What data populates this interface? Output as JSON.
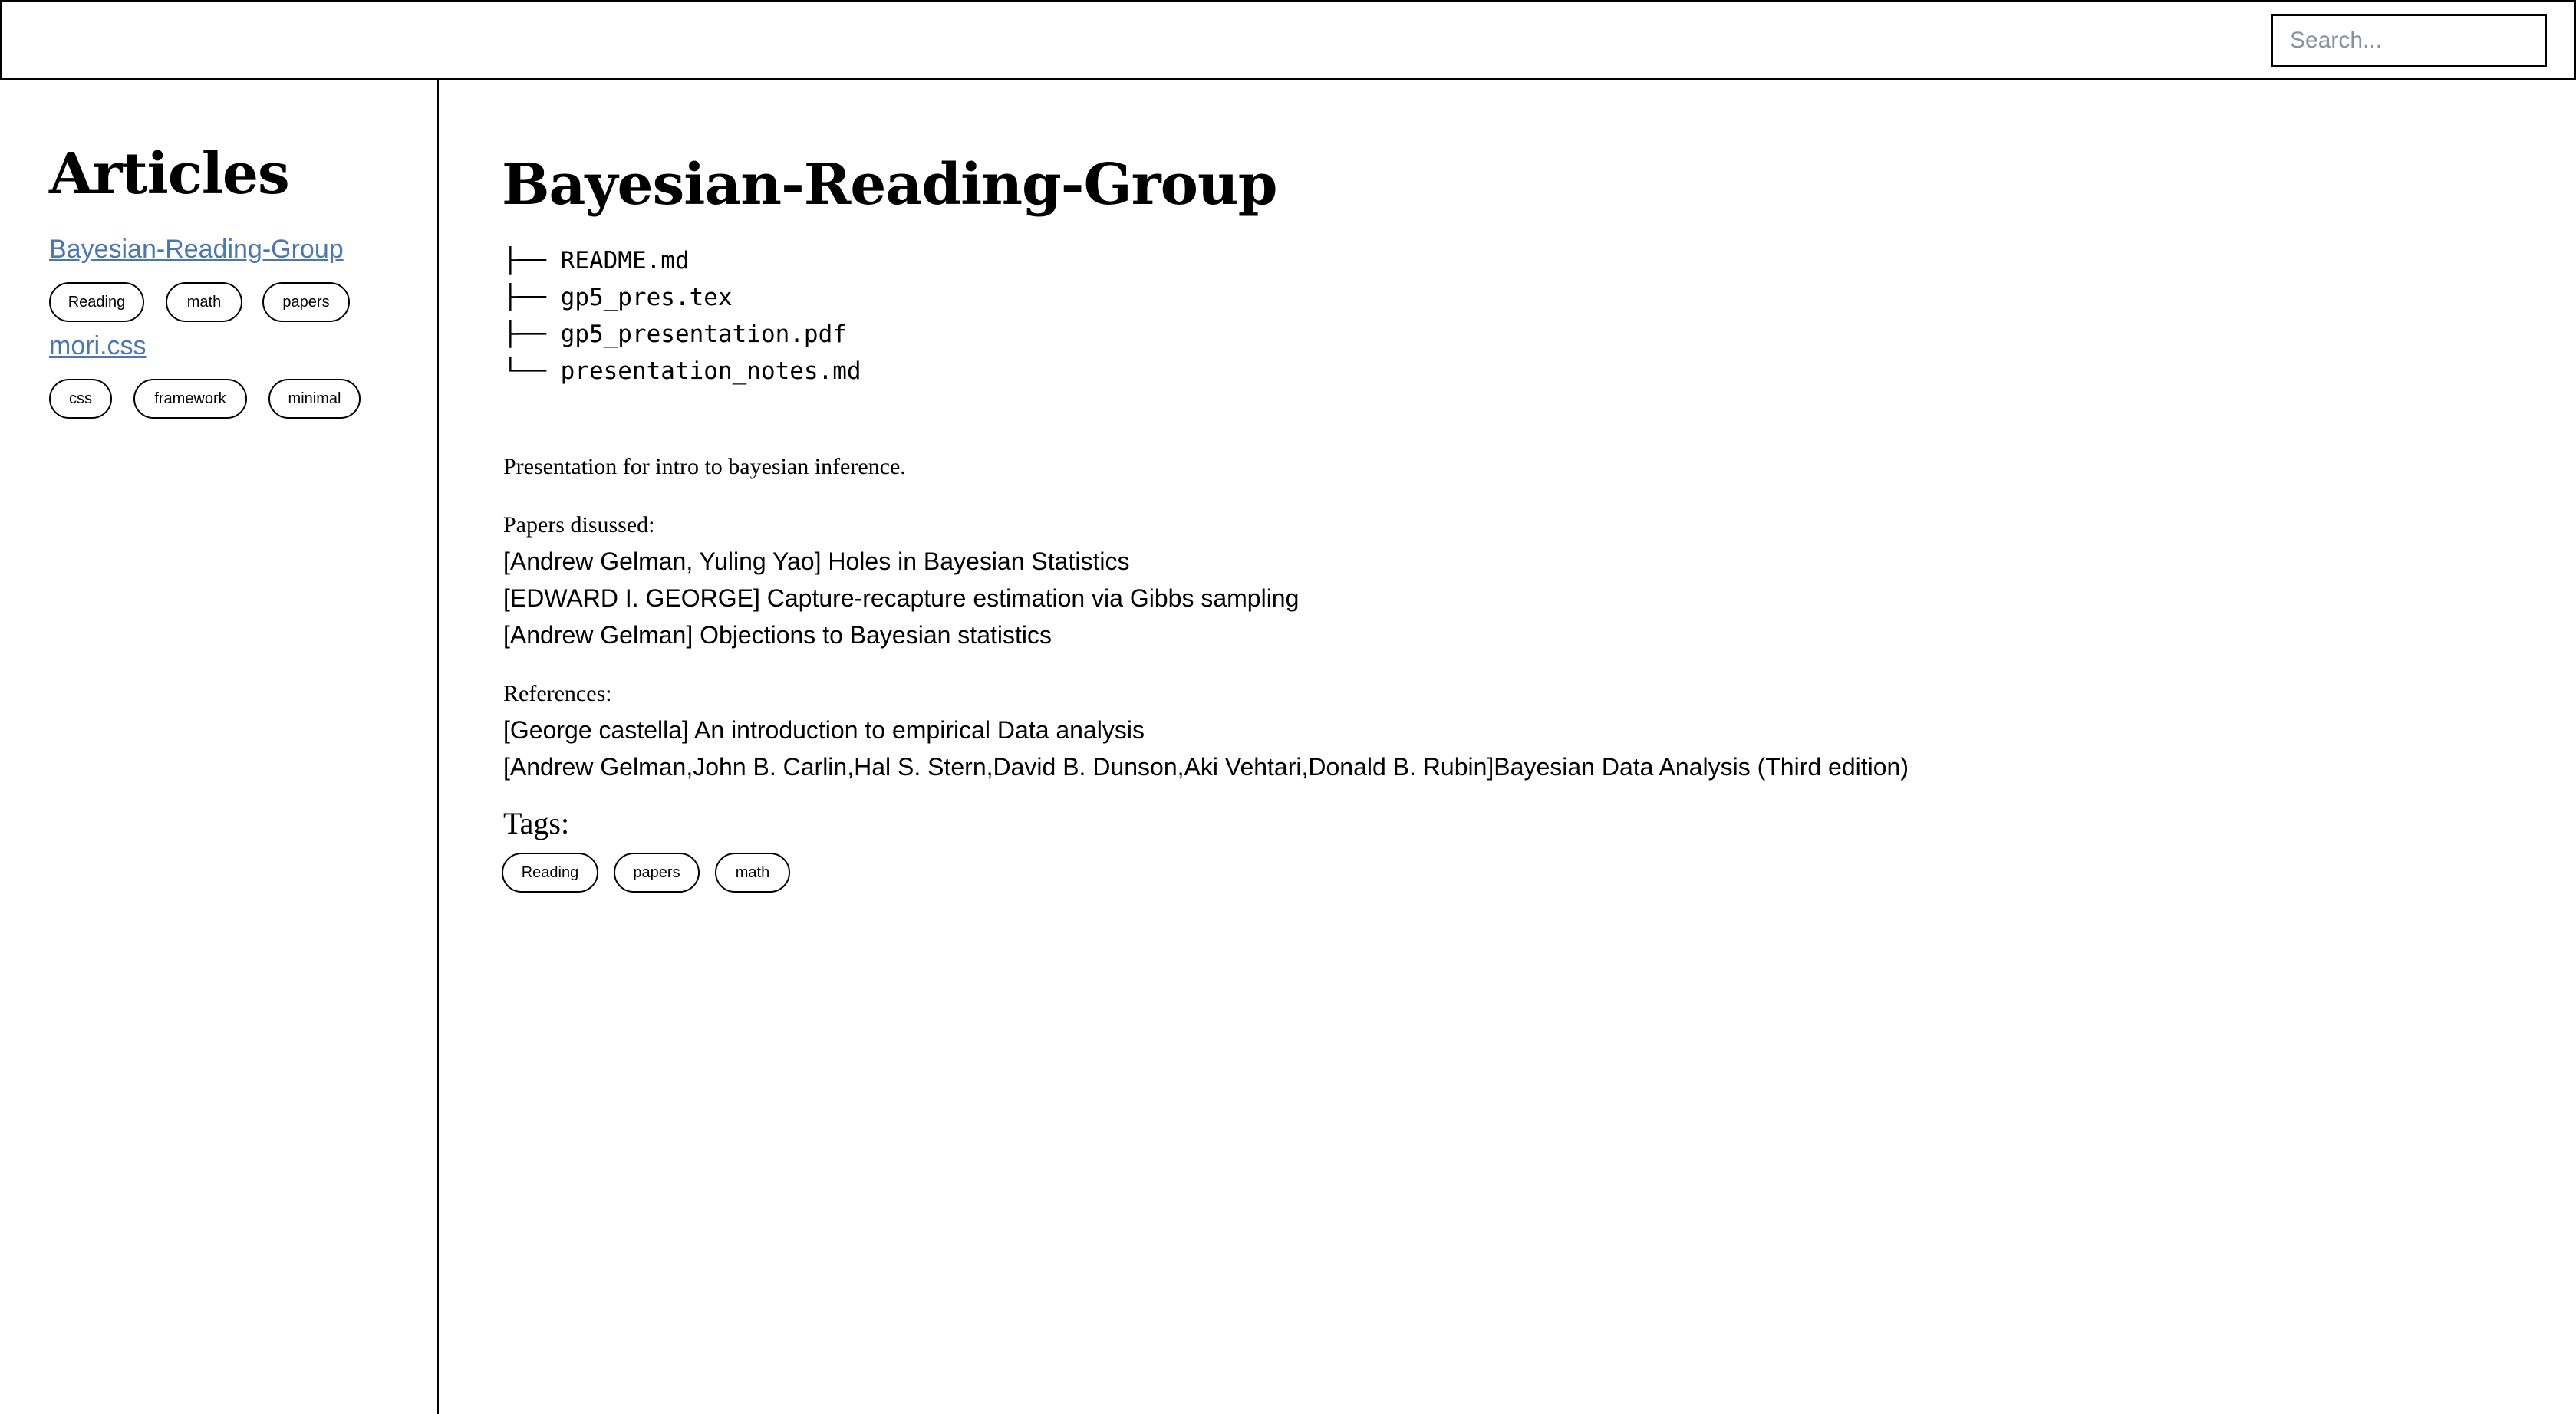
{
  "search": {
    "placeholder": "Search..."
  },
  "sidebar": {
    "title": "Articles",
    "articles": [
      {
        "title": "Bayesian-Reading-Group",
        "tags": [
          "Reading",
          "math",
          "papers"
        ]
      },
      {
        "title": "mori.css",
        "tags": [
          "css",
          "framework",
          "minimal"
        ]
      }
    ]
  },
  "main": {
    "title": "Bayesian-Reading-Group",
    "file_tree": [
      "├── README.md",
      "├── gp5_pres.tex",
      "├── gp5_presentation.pdf",
      "└── presentation_notes.md"
    ],
    "description": "Presentation for intro to bayesian inference.",
    "papers_heading": "Papers disussed:",
    "papers": [
      "[Andrew Gelman, Yuling Yao] Holes in Bayesian Statistics",
      "[EDWARD I. GEORGE] Capture-recapture estimation via Gibbs sampling",
      "[Andrew Gelman] Objections to Bayesian statistics"
    ],
    "references_heading": "References:",
    "references": [
      "[George castella] An introduction to empirical Data analysis",
      "[Andrew Gelman,John B. Carlin,Hal S. Stern,David B. Dunson,Aki Vehtari,Donald B. Rubin]Bayesian Data Analysis (Third edition)"
    ],
    "tags_label": "Tags:",
    "tags": [
      "Reading",
      "papers",
      "math"
    ]
  },
  "colors": {
    "link": "#4a76b4",
    "placeholder": "#8a8f99",
    "border": "#000000"
  }
}
